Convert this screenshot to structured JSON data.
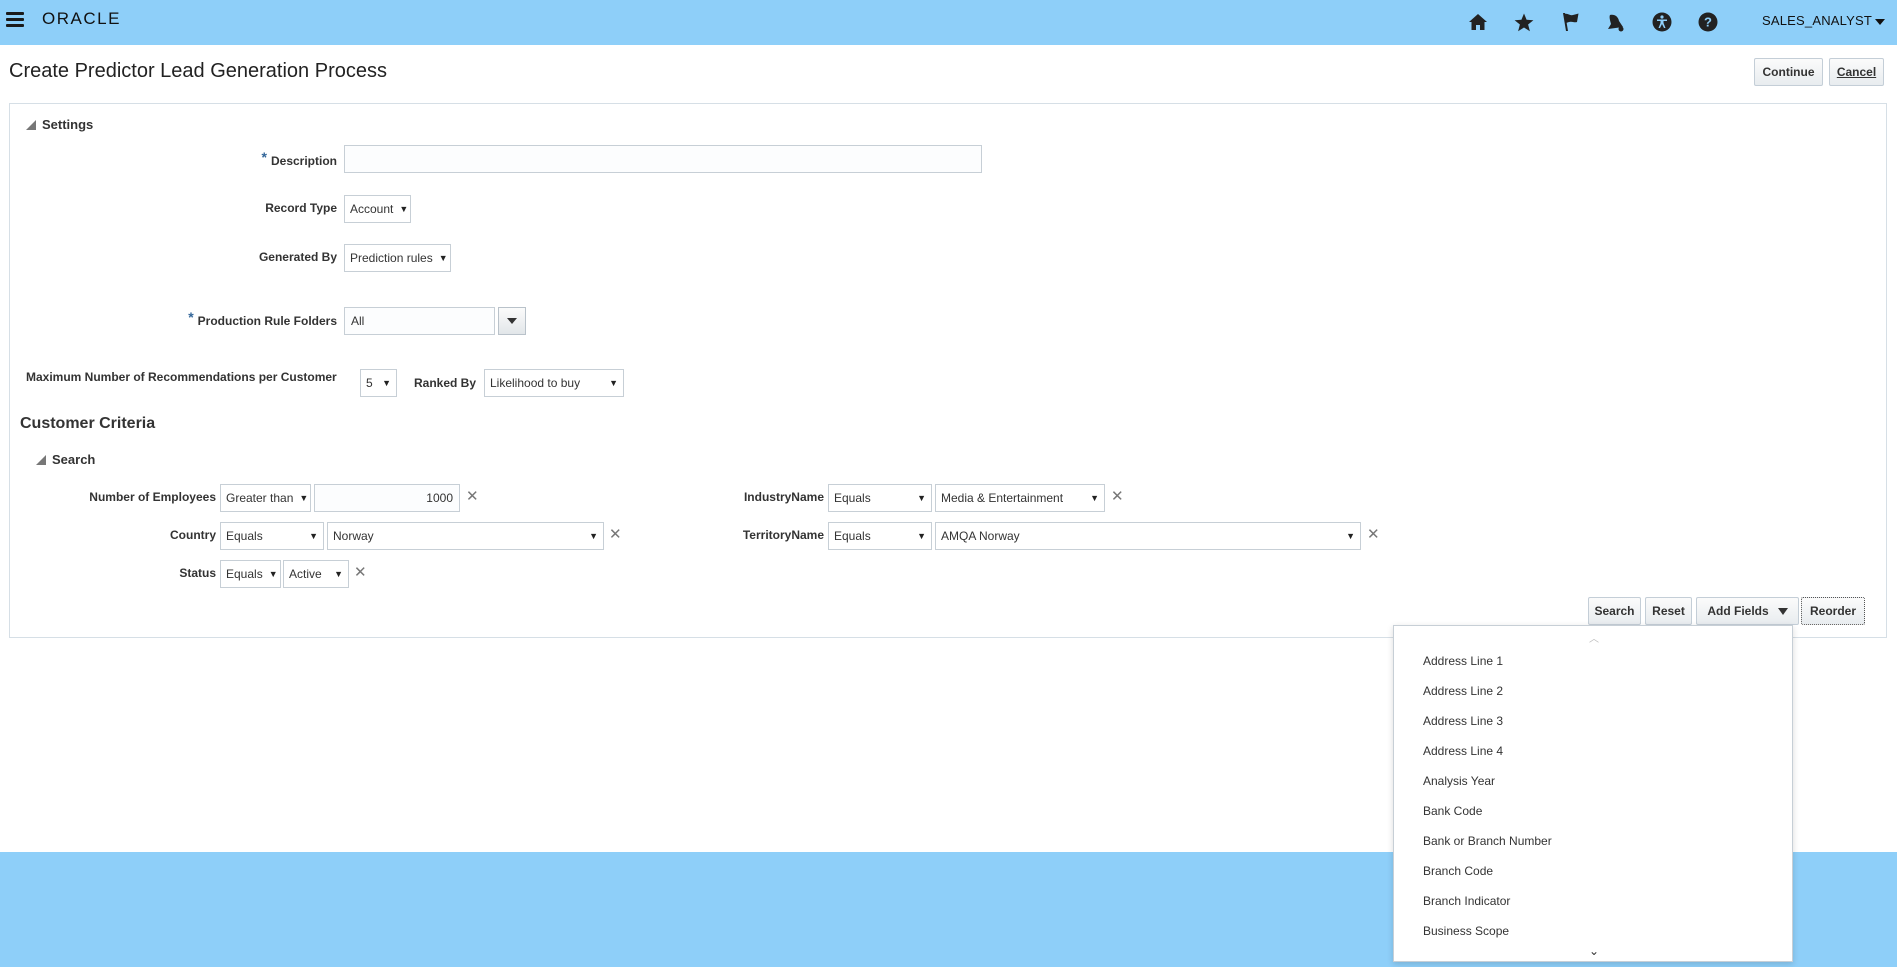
{
  "app": {
    "brand": "ORACLE",
    "user": "SALES_ANALYST",
    "icons": [
      "home-icon",
      "star-icon",
      "flag-icon",
      "bell-icon",
      "accessibility-icon",
      "help-icon"
    ]
  },
  "page": {
    "title": "Create Predictor Lead Generation Process",
    "continue_label": "Continue",
    "cancel_label": "Cancel"
  },
  "settings": {
    "header": "Settings",
    "description_label": "Description",
    "description_value": "",
    "record_type_label": "Record Type",
    "record_type_value": "Account",
    "generated_by_label": "Generated By",
    "generated_by_value": "Prediction rules",
    "rule_folders_label": "Production Rule Folders",
    "rule_folders_value": "All",
    "max_recs_label": "Maximum Number of Recommendations per Customer",
    "max_recs_value": "5",
    "ranked_by_label": "Ranked By",
    "ranked_by_value": "Likelihood to buy"
  },
  "criteria": {
    "title": "Customer Criteria",
    "search_header": "Search",
    "employees_label": "Number of Employees",
    "employees_op": "Greater than",
    "employees_value": "1000",
    "country_label": "Country",
    "country_op": "Equals",
    "country_value": "Norway",
    "status_label": "Status",
    "status_op": "Equals",
    "status_value": "Active",
    "industry_label": "IndustryName",
    "industry_op": "Equals",
    "industry_value": "Media & Entertainment",
    "territory_label": "TerritoryName",
    "territory_op": "Equals",
    "territory_value": "AMQA Norway",
    "search_btn": "Search",
    "reset_btn": "Reset",
    "add_fields_btn": "Add Fields",
    "reorder_btn": "Reorder"
  },
  "add_fields_menu": {
    "items": [
      "Address Line 1",
      "Address Line 2",
      "Address Line 3",
      "Address Line 4",
      "Analysis Year",
      "Bank Code",
      "Bank or Branch Number",
      "Branch Code",
      "Branch Indicator",
      "Business Scope"
    ]
  },
  "colors": {
    "banner": "#8ecff9",
    "panel": "#ffffff",
    "required_marker": "#336699"
  }
}
